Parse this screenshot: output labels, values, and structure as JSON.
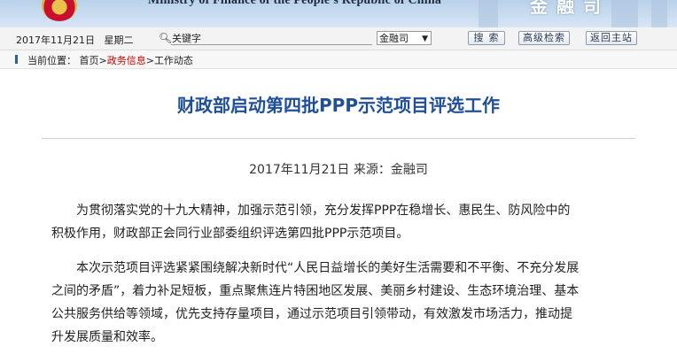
{
  "header": {
    "org_name_en": "Ministry of Finance of the People's Republic of China",
    "department_cn": "金融司"
  },
  "toolbar": {
    "date": "2017年11月21日",
    "weekday": "星期二",
    "search_placeholder": "关键字",
    "scope_select": "金融司",
    "search_button": "搜索",
    "advanced_search_button": "高级检索",
    "home_button": "返回主站"
  },
  "breadcrumb": {
    "label": "当前位置：",
    "items": [
      "首页",
      "政务信息",
      "工作动态"
    ],
    "separator": ">"
  },
  "article": {
    "title": "财政部启动第四批PPP示范项目评选工作",
    "meta": "2017年11月21日 来源：金融司",
    "paragraphs": [
      {
        "lines": [
          "为贯彻落实党的十九大精神，加强示范引领，充分发挥PPP在稳增长、惠民生、防风险中的",
          "积极作用，财政部正会同行业部委组织评选第四批PPP示范项目。"
        ]
      },
      {
        "lines": [
          "本次示范项目评选紧紧围绕解决新时代“人民日益增长的美好生活需要和不平衡、不充分发展",
          "之间的矛盾”，着力补足短板，重点聚焦连片特困地区发展、美丽乡村建设、生态环境治理、基本",
          "公共服务供给等领域，优先支持存量项目，通过示范项目引领带动，有效激发市场活力，推动提",
          "升发展质量和效率。"
        ]
      }
    ]
  },
  "colors": {
    "title_blue": "#1e4f97",
    "breadcrumb_red": "#c00000",
    "banner_blue": "#c9dcf0"
  }
}
